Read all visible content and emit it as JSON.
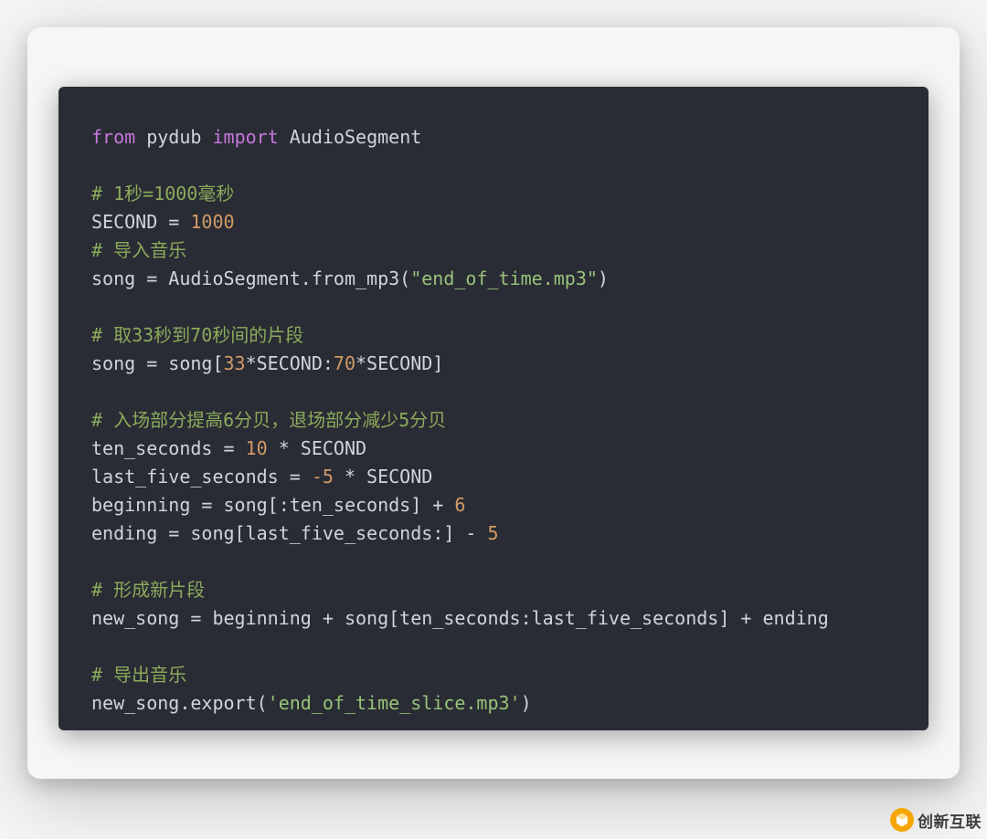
{
  "code": {
    "line1_from": "from",
    "line1_mod1": "pydub",
    "line1_import": "import",
    "line1_mod2": "AudioSegment",
    "cmt1": "# 1秒=1000毫秒",
    "line3a": "SECOND = ",
    "line3num": "1000",
    "cmt2": "# 导入音乐",
    "line5a": "song = AudioSegment.from_mp3(",
    "line5str": "\"end_of_time.mp3\"",
    "line5b": ")",
    "cmt3": "# 取33秒到70秒间的片段",
    "line7a": "song = song[",
    "line7n1": "33",
    "line7b": "*SECOND:",
    "line7n2": "70",
    "line7c": "*SECOND]",
    "cmt4": "# 入场部分提高6分贝，退场部分减少5分贝",
    "line9a": "ten_seconds = ",
    "line9n1": "10",
    "line9b": " * SECOND",
    "line10a": "last_five_seconds = ",
    "line10n1": "-5",
    "line10b": " * SECOND",
    "line11a": "beginning = song[:ten_seconds] + ",
    "line11n1": "6",
    "line12a": "ending = song[last_five_seconds:] - ",
    "line12n1": "5",
    "cmt5": "# 形成新片段",
    "line14": "new_song = beginning + song[ten_seconds:last_five_seconds] + ending",
    "cmt6": "# 导出音乐",
    "line16a": "new_song.export(",
    "line16str": "'end_of_time_slice.mp3'",
    "line16b": ")"
  },
  "watermark": {
    "text": "创新互联"
  }
}
